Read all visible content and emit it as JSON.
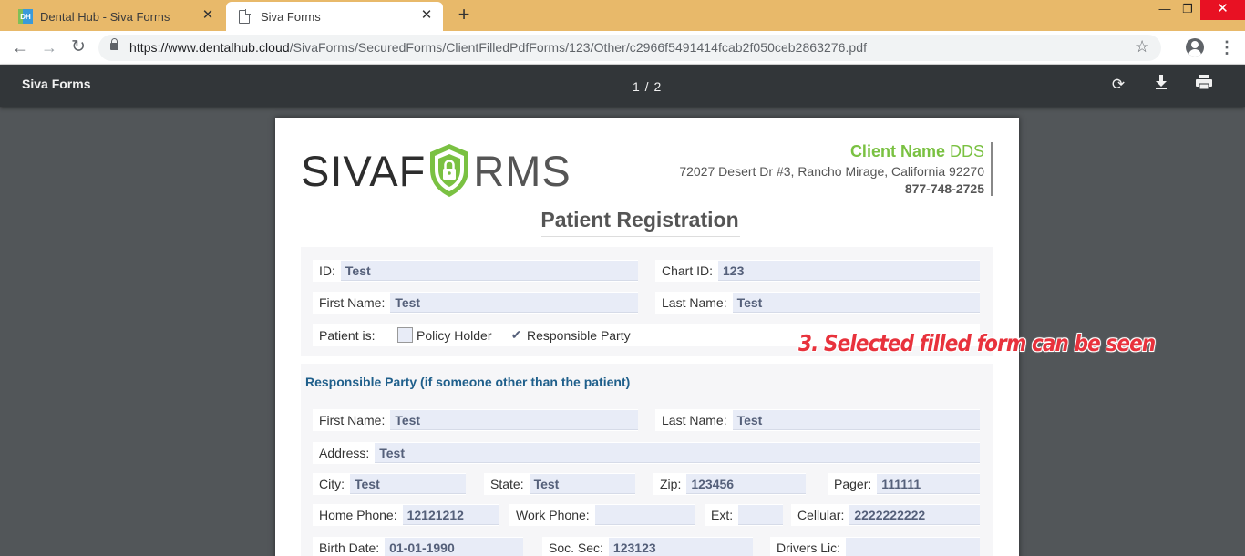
{
  "browser": {
    "tabs": [
      {
        "title": "Dental Hub - Siva Forms",
        "favicon": "DH",
        "active": false
      },
      {
        "title": "Siva Forms",
        "active": true
      }
    ],
    "new_tab_icon": "+",
    "close_icon": "✕",
    "url_host": "https://www.dentalhub.cloud",
    "url_path": "/SivaForms/SecuredForms/ClientFilledPdfForms/123/Other/c2966f5491414fcab2f050ceb2863276.pdf",
    "tabstrip_color": "#e8b96a"
  },
  "pdf_viewer": {
    "title": "Siva Forms",
    "page_indicator": "1 / 2",
    "toolbar_color": "#323639"
  },
  "document": {
    "logo": {
      "left": "SIVAF",
      "right": "RMS"
    },
    "client_name": "Client Name",
    "client_suffix": "DDS",
    "client_address": "72027 Desert Dr #3, Rancho Mirage, California 92270",
    "client_phone": "877-748-2725",
    "form_title": "Patient Registration",
    "patient": {
      "id_label": "ID:",
      "id_value": "Test",
      "chart_label": "Chart ID:",
      "chart_value": "123",
      "first_label": "First Name:",
      "first_value": "Test",
      "last_label": "Last Name:",
      "last_value": "Test",
      "patient_is_label": "Patient is:",
      "policy_holder_label": "Policy Holder",
      "policy_holder_checked": false,
      "responsible_party_label": "Responsible Party",
      "responsible_party_checked": true,
      "check_glyph": "✔"
    },
    "responsible": {
      "heading": "Responsible Party (if someone other than the patient)",
      "first_label": "First Name:",
      "first_value": "Test",
      "last_label": "Last Name:",
      "last_value": "Test",
      "address_label": "Address:",
      "address_value": "Test",
      "city_label": "City:",
      "city_value": "Test",
      "state_label": "State:",
      "state_value": "Test",
      "zip_label": "Zip:",
      "zip_value": "123456",
      "pager_label": "Pager:",
      "pager_value": "111111",
      "home_label": "Home Phone:",
      "home_value": "12121212",
      "work_label": "Work Phone:",
      "work_value": "",
      "ext_label": "Ext:",
      "ext_value": "",
      "cell_label": "Cellular:",
      "cell_value": "2222222222",
      "birth_label": "Birth Date:",
      "birth_value": "01-01-1990",
      "soc_label": "Soc. Sec:",
      "soc_value": "123123",
      "lic_label": "Drivers Lic:",
      "lic_value": ""
    },
    "accent_green": "#7ac142",
    "heading_blue": "#1f5f8b"
  },
  "annotation": "3. Selected filled form can be seen"
}
